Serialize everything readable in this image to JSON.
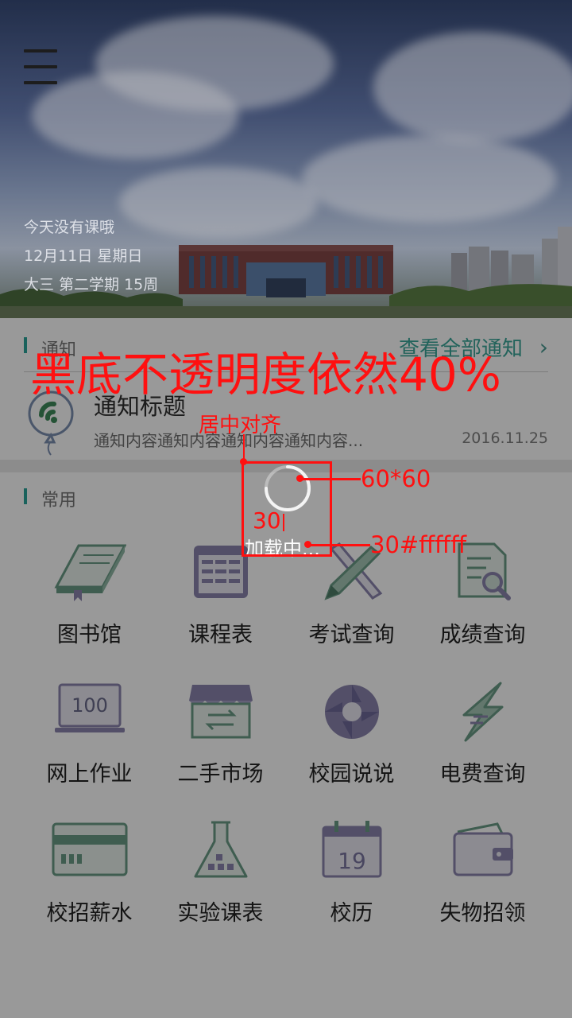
{
  "header": {
    "today_status": "今天没有课哦",
    "date": "12月11日 星期日",
    "term": "大三 第二学期 15周"
  },
  "notice": {
    "section_title": "通知",
    "view_all_label": "查看全部通知",
    "item": {
      "title": "通知标题",
      "content": "通知内容通知内容通知内容通知内容...",
      "date": "2016.11.25"
    }
  },
  "common": {
    "section_title": "常用",
    "items": [
      {
        "label": "图书馆",
        "icon": "library-book-icon"
      },
      {
        "label": "课程表",
        "icon": "timetable-icon"
      },
      {
        "label": "考试查询",
        "icon": "exam-pencil-ruler-icon"
      },
      {
        "label": "成绩查询",
        "icon": "grade-search-icon"
      },
      {
        "label": "网上作业",
        "icon": "laptop-100-icon"
      },
      {
        "label": "二手市场",
        "icon": "market-store-icon"
      },
      {
        "label": "校园说说",
        "icon": "aperture-icon"
      },
      {
        "label": "电费查询",
        "icon": "lightning-icon"
      },
      {
        "label": "校招薪水",
        "icon": "salary-card-icon"
      },
      {
        "label": "实验课表",
        "icon": "flask-icon"
      },
      {
        "label": "校历",
        "icon": "calendar-19-icon",
        "calendar_day": "19"
      },
      {
        "label": "失物招领",
        "icon": "wallet-icon"
      }
    ],
    "laptop_text": "100"
  },
  "loading": {
    "text": "加载中..."
  },
  "annotations": {
    "overlay_note": "黑底不透明度依然40%",
    "center_note": "居中对齐",
    "size_note": "60*60",
    "font_size_note": "30",
    "font_color_note": "30#ffffff"
  },
  "colors": {
    "accent": "#2aa39a",
    "icon_green": "#6a9b86",
    "icon_purple": "#8a84ad",
    "annotation_red": "#ff1010",
    "overlay": "rgba(0,0,0,0.4)"
  }
}
